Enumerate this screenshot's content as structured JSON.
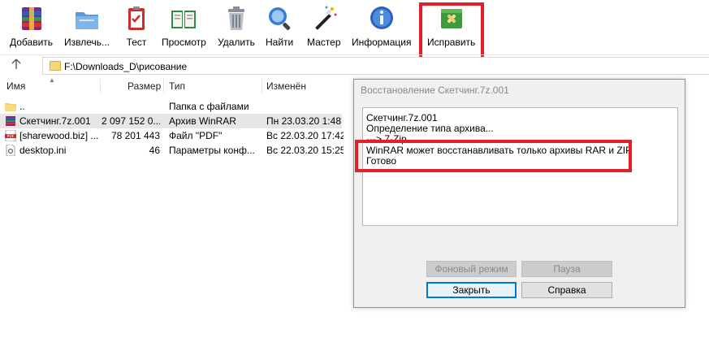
{
  "toolbar": {
    "buttons": [
      {
        "label": "Добавить",
        "icon": "winrar-add-icon"
      },
      {
        "label": "Извлечь...",
        "icon": "extract-folder-icon"
      },
      {
        "label": "Тест",
        "icon": "test-clipboard-icon"
      },
      {
        "label": "Просмотр",
        "icon": "view-book-icon"
      },
      {
        "label": "Удалить",
        "icon": "trash-can-icon"
      },
      {
        "label": "Найти",
        "icon": "magnifier-icon"
      },
      {
        "label": "Мастер",
        "icon": "wizard-wand-icon"
      },
      {
        "label": "Информация",
        "icon": "info-icon"
      },
      {
        "label": "Исправить",
        "icon": "repair-kit-icon"
      }
    ]
  },
  "address": {
    "path": "F:\\Downloads_D\\рисование"
  },
  "file_list": {
    "columns": [
      "Имя",
      "Размер",
      "Тип",
      "Изменён"
    ],
    "rows": [
      {
        "name": "..",
        "size": "",
        "type": "Папка с файлами",
        "modified": "",
        "icon": "folder-icon"
      },
      {
        "name": "Скетчинг.7z.001",
        "size": "2 097 152 0...",
        "type": "Архив WinRAR",
        "modified": "Пн 23.03.20 1:48",
        "icon": "winrar-archive-icon"
      },
      {
        "name": "[sharewood.biz] ...",
        "size": "78 201 443",
        "type": "Файл \"PDF\"",
        "modified": "Вс 22.03.20 17:42",
        "icon": "pdf-icon"
      },
      {
        "name": "desktop.ini",
        "size": "46",
        "type": "Параметры конф...",
        "modified": "Вс 22.03.20 15:25",
        "icon": "settings-file-icon"
      }
    ]
  },
  "dialog": {
    "title": "Восстановление Скетчинг.7z.001",
    "log": [
      "Скетчинг.7z.001",
      "Определение типа архива...",
      "---> 7-Zip",
      "WinRAR может восстанавливать только архивы RAR и ZIP",
      "Готово"
    ],
    "buttons": {
      "background": "Фоновый режим",
      "pause": "Пауза",
      "close": "Закрыть",
      "help": "Справка"
    }
  },
  "colors": {
    "highlight": "#e0202a",
    "selection": "#e6e6e6",
    "default_button_border": "#0078d7"
  }
}
